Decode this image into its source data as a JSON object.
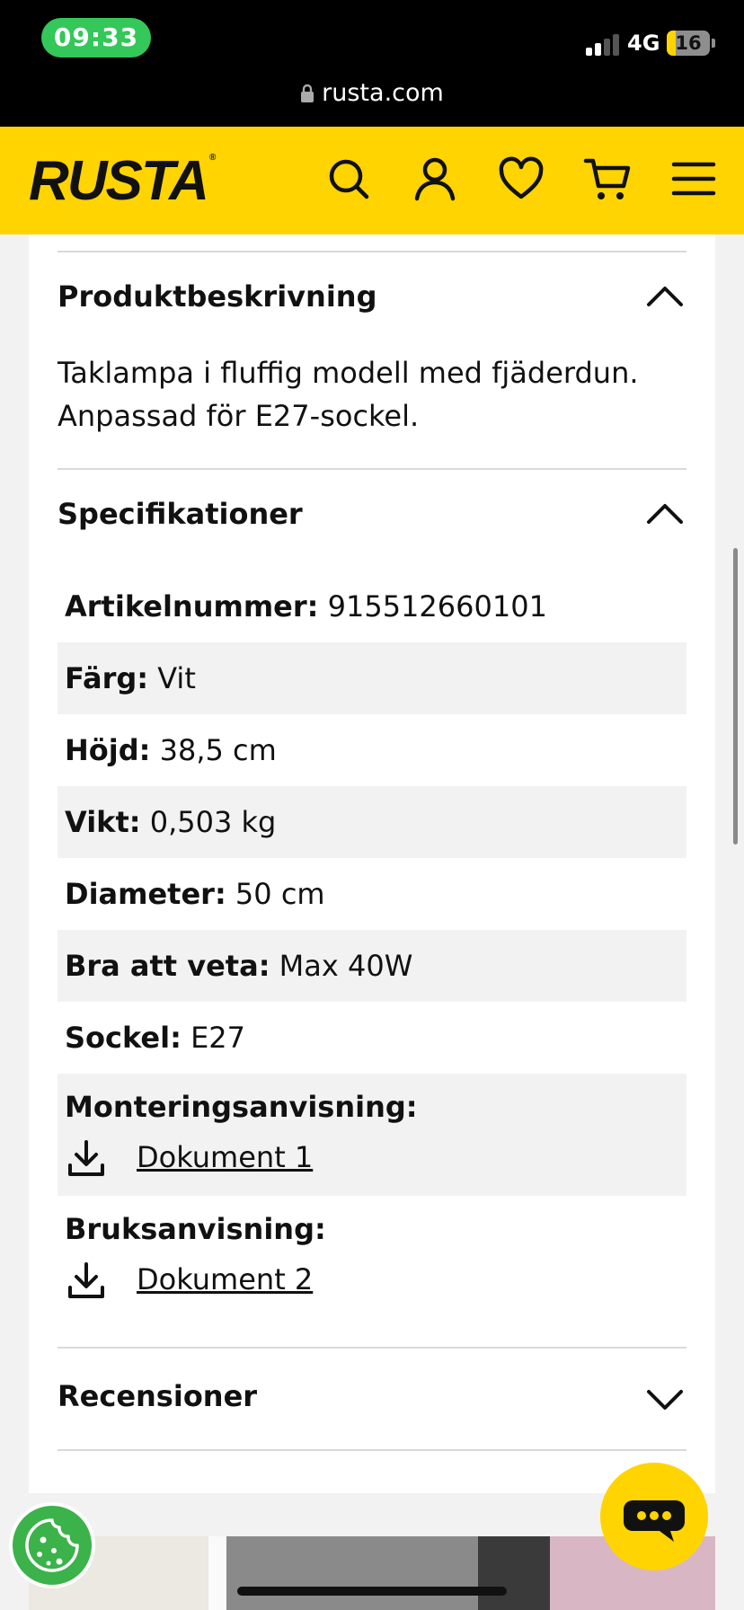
{
  "status_bar": {
    "time": "09:33",
    "network": "4G",
    "battery": "16",
    "url": "rusta.com"
  },
  "header": {
    "logo": "RUSTA",
    "logo_mark": "®"
  },
  "description": {
    "title": "Produktbeskrivning",
    "text": "Taklampa i fluffig modell med fjäderdun. Anpassad för E27-sockel."
  },
  "specs": {
    "title": "Specifikationer",
    "rows": [
      {
        "label": "Artikelnummer:",
        "value": "915512660101"
      },
      {
        "label": "Färg:",
        "value": "Vit"
      },
      {
        "label": "Höjd:",
        "value": "38,5 cm"
      },
      {
        "label": "Vikt:",
        "value": "0,503 kg"
      },
      {
        "label": "Diameter:",
        "value": "50 cm"
      },
      {
        "label": "Bra att veta:",
        "value": "Max 40W"
      },
      {
        "label": "Sockel:",
        "value": "E27"
      }
    ],
    "documents": [
      {
        "label": "Monteringsanvisning:",
        "link": "Dokument 1"
      },
      {
        "label": "Bruksanvisning:",
        "link": "Dokument 2"
      }
    ]
  },
  "reviews": {
    "title": "Recensioner"
  },
  "colors": {
    "brand_yellow": "#ffd400",
    "cookie_green": "#3cb24a",
    "status_green": "#34c759"
  },
  "icons": [
    "lock-icon",
    "search-icon",
    "account-icon",
    "heart-icon",
    "cart-icon",
    "menu-icon",
    "chevron-up-icon",
    "chevron-down-icon",
    "download-icon",
    "cookie-icon",
    "chat-icon"
  ]
}
